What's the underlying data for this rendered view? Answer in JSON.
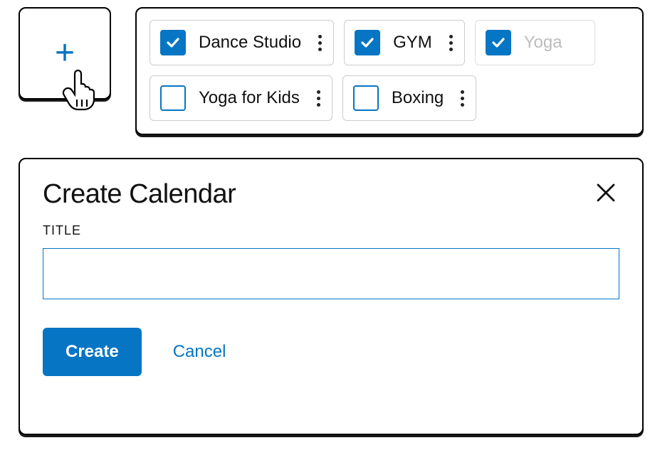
{
  "add_button": {
    "symbol": "+"
  },
  "calendars": [
    {
      "label": "Dance Studio",
      "checked": true,
      "faded": false
    },
    {
      "label": "GYM",
      "checked": true,
      "faded": false
    },
    {
      "label": "Yoga",
      "checked": true,
      "faded": true
    },
    {
      "label": "Yoga for Kids",
      "checked": false,
      "faded": false
    },
    {
      "label": "Boxing",
      "checked": false,
      "faded": false
    }
  ],
  "modal": {
    "title": "Create Calendar",
    "field_label": "TITLE",
    "input_value": "",
    "create_label": "Create",
    "cancel_label": "Cancel"
  },
  "colors": {
    "accent": "#0675c4"
  }
}
